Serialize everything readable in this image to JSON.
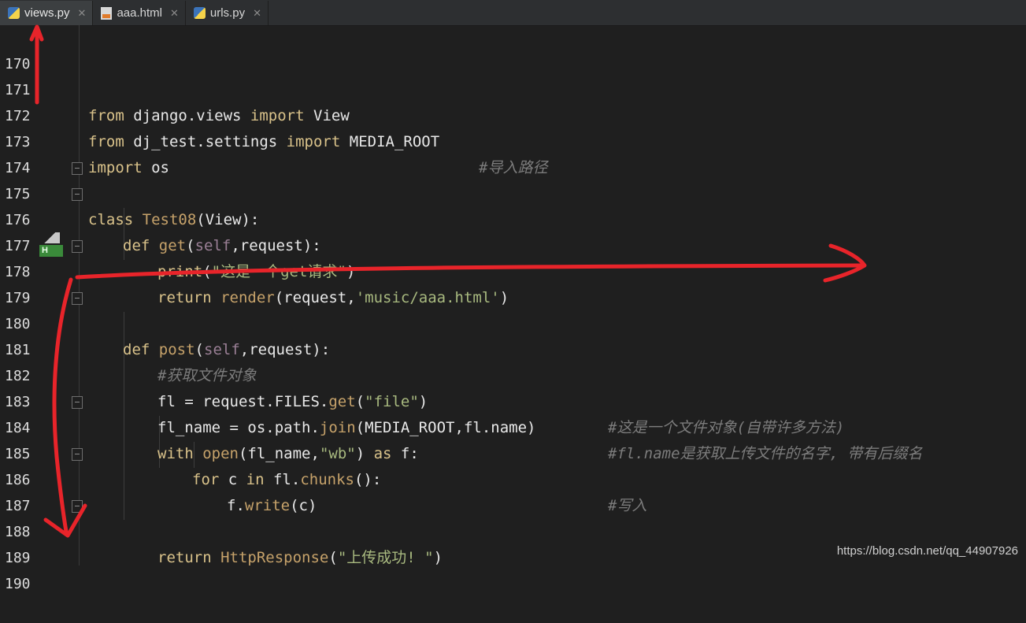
{
  "tabs": [
    {
      "label": "views.py",
      "icon": "python-file-icon",
      "active": true
    },
    {
      "label": "aaa.html",
      "icon": "html-file-icon",
      "active": false
    },
    {
      "label": "urls.py",
      "icon": "python-file-icon",
      "active": false
    }
  ],
  "lines": [
    {
      "n": "170"
    },
    {
      "n": "171"
    },
    {
      "n": "172"
    },
    {
      "n": "173"
    },
    {
      "n": "174"
    },
    {
      "n": "175"
    },
    {
      "n": "176"
    },
    {
      "n": "177"
    },
    {
      "n": "178"
    },
    {
      "n": "179"
    },
    {
      "n": "180"
    },
    {
      "n": "181"
    },
    {
      "n": "182"
    },
    {
      "n": "183"
    },
    {
      "n": "184"
    },
    {
      "n": "185"
    },
    {
      "n": "186"
    },
    {
      "n": "187"
    },
    {
      "n": "188"
    },
    {
      "n": "189"
    },
    {
      "n": "190"
    }
  ],
  "code": {
    "l171": {
      "kw1": "from",
      "mod": " django.views ",
      "kw2": "import",
      "name": " View"
    },
    "l172": {
      "kw1": "from",
      "mod": " dj_test.settings ",
      "kw2": "import",
      "name": " MEDIA_ROOT",
      "comment": "#导入路径"
    },
    "l173": {
      "kw1": "import",
      "name": " os"
    },
    "l175": {
      "kw": "class",
      "cls": "Test08",
      "rest": "(View):"
    },
    "l176": {
      "kw": "def",
      "fn": "get",
      "p1": "(",
      "self": "self",
      "rest": ",request):"
    },
    "l177": {
      "fn": "print",
      "p1": "(",
      "str": "\"这是一个get请求\"",
      "p2": ")"
    },
    "l178": {
      "kw": "return",
      "fn": "render",
      "p1": "(request,",
      "str": "'music/aaa.html'",
      "p2": ")"
    },
    "l180": {
      "kw": "def",
      "fn": "post",
      "p1": "(",
      "self": "self",
      "rest": ",request):"
    },
    "l181": {
      "comment": "#获取文件对象"
    },
    "l182": {
      "a": "fl = request.FILES.",
      "fn": "get",
      "p1": "(",
      "str": "\"file\"",
      "p2": ")",
      "comment": "#这是一个文件对象(自带许多方法)"
    },
    "l183": {
      "a": "fl_name = os.path.",
      "fn": "join",
      "p1": "(MEDIA_ROOT,fl.name)",
      "comment": "#fl.name是获取上传文件的名字, 带有后缀名"
    },
    "l184": {
      "kw": "with",
      "fn": "open",
      "p1": "(fl_name,",
      "str": "\"wb\"",
      "p2": ") ",
      "kw2": "as",
      "rest": " f:"
    },
    "l185": {
      "kw": "for",
      "a": " c ",
      "kw2": "in",
      "b": " fl.",
      "fn": "chunks",
      "p1": "():",
      "comment": "#写入"
    },
    "l186": {
      "a": "f.",
      "fn": "write",
      "p1": "(c)"
    },
    "l188": {
      "kw": "return",
      "fn": "HttpResponse",
      "p1": "(",
      "str": "\"上传成功! \"",
      "p2": ")"
    }
  },
  "watermark": "https://blog.csdn.net/qq_44907926",
  "colors": {
    "background": "#1f1f1f",
    "keyword": "#d9c28a",
    "string": "#a8b97f",
    "comment": "#7c7c7c",
    "annotation_red": "#e8242a"
  }
}
